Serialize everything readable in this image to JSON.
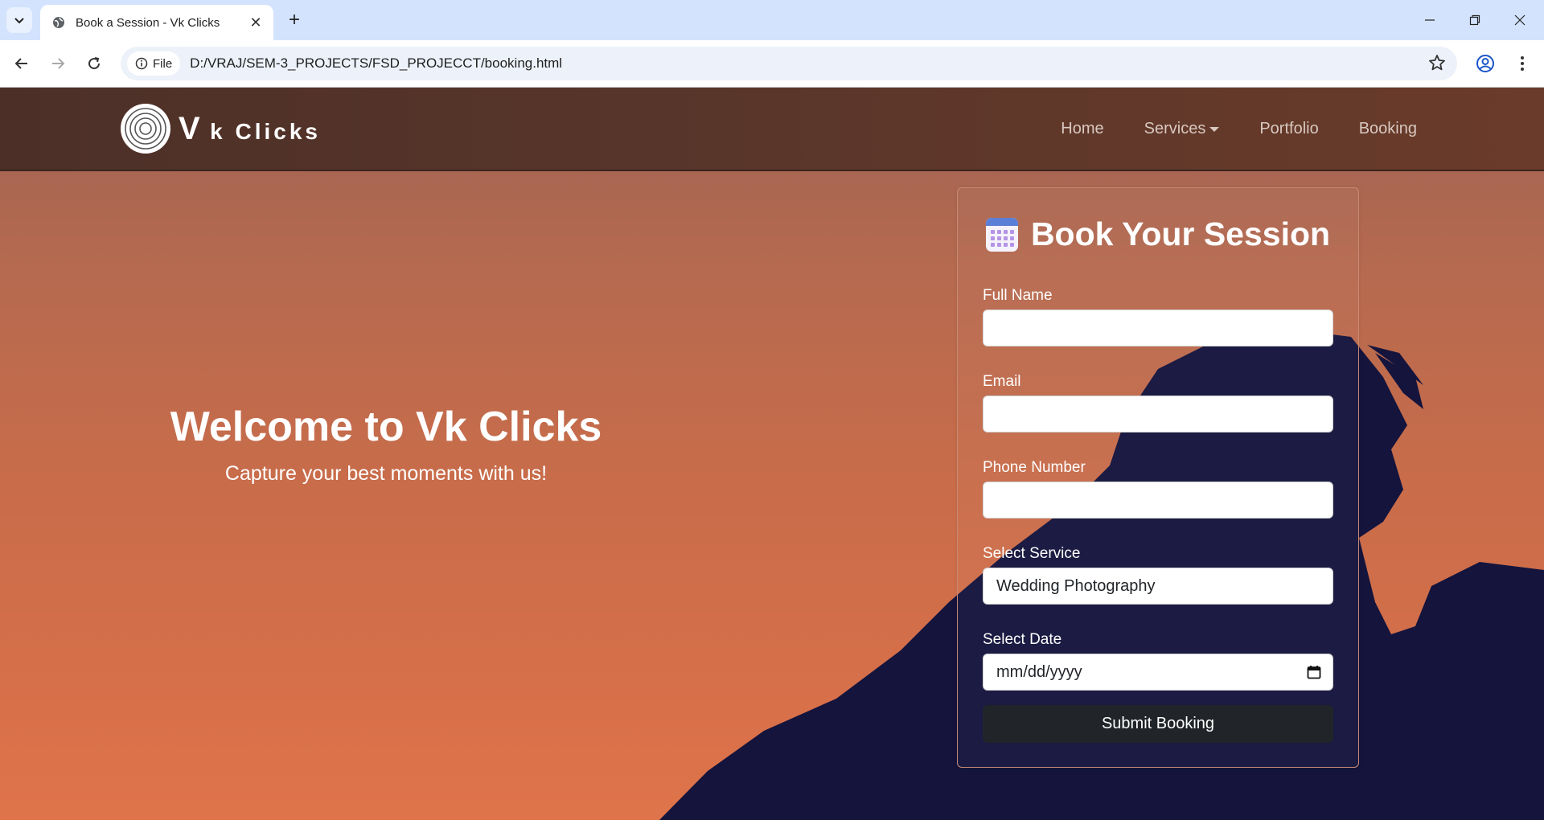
{
  "browser": {
    "tab_title": "Book a Session - Vk Clicks",
    "chip_label": "File",
    "url": "D:/VRAJ/SEM-3_PROJECTS/FSD_PROJECCT/booking.html"
  },
  "navbar": {
    "brand_v": "V",
    "brand_rest": "k Clicks",
    "links": [
      "Home",
      "Services",
      "Portfolio",
      "Booking"
    ]
  },
  "hero": {
    "title": "Welcome to Vk Clicks",
    "subtitle": "Capture your best moments with us!"
  },
  "form": {
    "title": "Book Your Session",
    "full_name_label": "Full Name",
    "email_label": "Email",
    "phone_label": "Phone Number",
    "service_label": "Select Service",
    "service_value": "Wedding Photography",
    "date_label": "Select Date",
    "date_placeholder": "mm/dd/yyyy",
    "submit_label": "Submit Booking"
  },
  "icons": [
    "tab-list-icon",
    "globe-icon",
    "close-icon",
    "plus-icon",
    "minimize-icon",
    "restore-icon",
    "window-close-icon",
    "back-icon",
    "forward-icon",
    "reload-icon",
    "info-icon",
    "star-icon",
    "profile-icon",
    "menu-icon",
    "calendar-icon",
    "date-picker-icon",
    "camera-lens-logo"
  ],
  "colors": {
    "navbar": "#5a362a",
    "submit_button": "#212529",
    "background_orange": "#d8704a",
    "silhouette": "#14143d"
  }
}
